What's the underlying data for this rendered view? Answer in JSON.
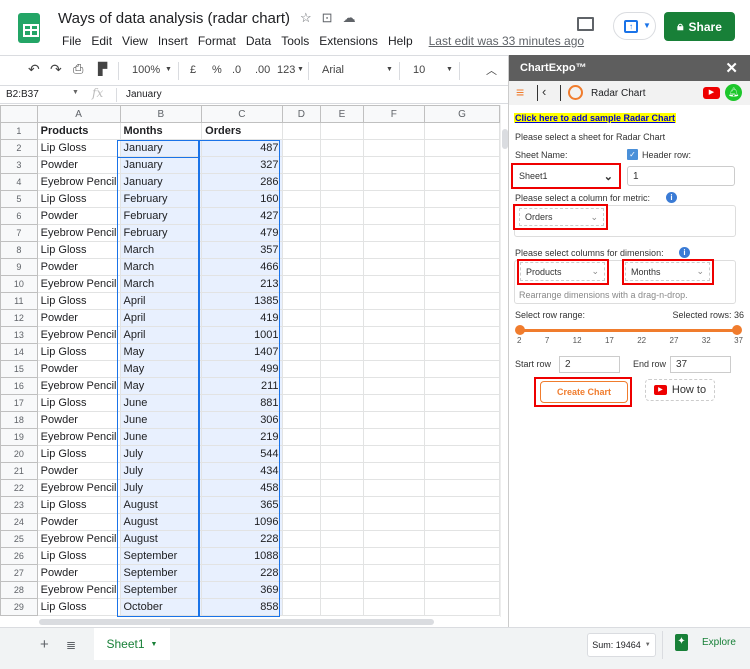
{
  "app": {
    "doc_title": "Ways of data analysis (radar chart)",
    "menu": [
      "File",
      "Edit",
      "View",
      "Insert",
      "Format",
      "Data",
      "Tools",
      "Extensions",
      "Help"
    ],
    "last_edit": "Last edit was 33 minutes ago",
    "share_label": "Share"
  },
  "toolbar": {
    "zoom": "100%",
    "currency": "£",
    "percent": "%",
    "dec_decrease": ".0",
    "dec_increase": ".00",
    "format_more": "123",
    "font": "Arial",
    "font_size": "10"
  },
  "formula_bar": {
    "name_box": "B2:B37",
    "fx": "fx",
    "value": "January"
  },
  "sheet": {
    "columns": [
      "A",
      "B",
      "C",
      "D",
      "E",
      "F",
      "G"
    ],
    "header": [
      "Products",
      "Months",
      "Orders"
    ],
    "rows": [
      [
        "Lip Gloss",
        "January",
        "487"
      ],
      [
        "Powder",
        "January",
        "327"
      ],
      [
        "Eyebrow Pencil",
        "January",
        "286"
      ],
      [
        "Lip Gloss",
        "February",
        "160"
      ],
      [
        "Powder",
        "February",
        "427"
      ],
      [
        "Eyebrow Pencil",
        "February",
        "479"
      ],
      [
        "Lip Gloss",
        "March",
        "357"
      ],
      [
        "Powder",
        "March",
        "466"
      ],
      [
        "Eyebrow Pencil",
        "March",
        "213"
      ],
      [
        "Lip Gloss",
        "April",
        "1385"
      ],
      [
        "Powder",
        "April",
        "419"
      ],
      [
        "Eyebrow Pencil",
        "April",
        "1001"
      ],
      [
        "Lip Gloss",
        "May",
        "1407"
      ],
      [
        "Powder",
        "May",
        "499"
      ],
      [
        "Eyebrow Pencil",
        "May",
        "211"
      ],
      [
        "Lip Gloss",
        "June",
        "881"
      ],
      [
        "Powder",
        "June",
        "306"
      ],
      [
        "Eyebrow Pencil",
        "June",
        "219"
      ],
      [
        "Lip Gloss",
        "July",
        "544"
      ],
      [
        "Powder",
        "July",
        "434"
      ],
      [
        "Eyebrow Pencil",
        "July",
        "458"
      ],
      [
        "Lip Gloss",
        "August",
        "365"
      ],
      [
        "Powder",
        "August",
        "1096"
      ],
      [
        "Eyebrow Pencil",
        "August",
        "228"
      ],
      [
        "Lip Gloss",
        "September",
        "1088"
      ],
      [
        "Powder",
        "September",
        "228"
      ],
      [
        "Eyebrow Pencil",
        "September",
        "369"
      ],
      [
        "Lip Gloss",
        "October",
        "858"
      ]
    ]
  },
  "bottom": {
    "sheet_tab": "Sheet1",
    "sum": "Sum: 19464",
    "explore": "Explore"
  },
  "panel": {
    "title": "ChartExpo™",
    "chart_name": "Radar Chart",
    "sample_link": "Click here to add sample Radar Chart",
    "select_sheet_label": "Please select a sheet for Radar Chart",
    "sheet_name_label": "Sheet Name:",
    "header_row_label": "Header row:",
    "sheet_name_value": "Sheet1",
    "header_row_value": "1",
    "metric_label": "Please select a column for metric:",
    "metric_value": "Orders",
    "dimension_label": "Please select columns for dimension:",
    "dimension_values": [
      "Products",
      "Months"
    ],
    "drag_hint": "Rearrange dimensions with a drag-n-drop.",
    "row_range_label": "Select row range:",
    "selected_rows": "Selected rows: 36",
    "range_ticks": [
      "2",
      "7",
      "12",
      "17",
      "22",
      "27",
      "32",
      "37"
    ],
    "range_start_fraction": 0,
    "range_end_fraction": 1,
    "start_row_label": "Start row",
    "start_row_value": "2",
    "end_row_label": "End row",
    "end_row_value": "37",
    "create_label": "Create Chart",
    "howto_label": "How to",
    "accent_color": "#f07c2d"
  }
}
